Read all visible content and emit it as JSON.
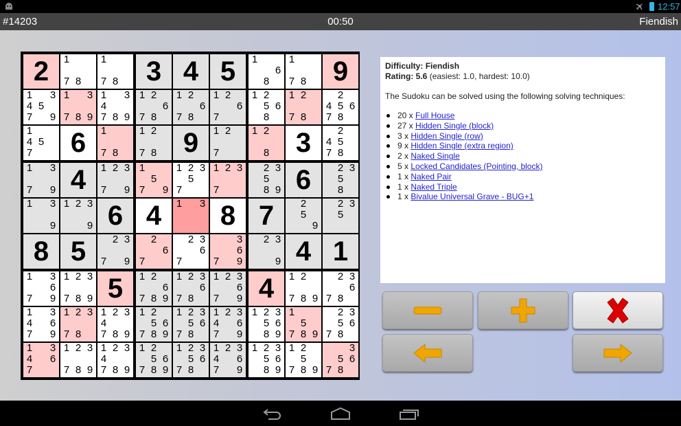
{
  "status_bar": {
    "time": "12:57"
  },
  "header": {
    "puzzle_id": "#14203",
    "timer": "00:50",
    "difficulty": "Fiendish"
  },
  "board": {
    "legend": {
      "w": "white",
      "g": "gray-region",
      "p": "highlight-pink",
      "s": "selected-dark-pink"
    },
    "colors": {
      "w": "#ffffff",
      "g": "#e3e3e3",
      "p": "#ffcccc",
      "s": "#ff9e9e"
    },
    "rows": [
      [
        {
          "bg": "p",
          "v": "2"
        },
        {
          "bg": "w",
          "c": [
            1,
            7,
            8
          ]
        },
        {
          "bg": "w",
          "c": [
            1,
            7,
            8
          ]
        },
        {
          "bg": "g",
          "v": "3"
        },
        {
          "bg": "g",
          "v": "4"
        },
        {
          "bg": "g",
          "v": "5"
        },
        {
          "bg": "w",
          "c": [
            1,
            6,
            8
          ]
        },
        {
          "bg": "w",
          "c": [
            1,
            7,
            8
          ]
        },
        {
          "bg": "p",
          "v": "9"
        }
      ],
      [
        {
          "bg": "w",
          "c": [
            1,
            3,
            4,
            5,
            7,
            9
          ]
        },
        {
          "bg": "p",
          "c": [
            1,
            3,
            7,
            8,
            9
          ]
        },
        {
          "bg": "w",
          "c": [
            1,
            3,
            4,
            7,
            8,
            9
          ]
        },
        {
          "bg": "g",
          "c": [
            1,
            2,
            6,
            7,
            8
          ]
        },
        {
          "bg": "g",
          "c": [
            1,
            2,
            6,
            7,
            8
          ]
        },
        {
          "bg": "g",
          "c": [
            1,
            2,
            6,
            7
          ]
        },
        {
          "bg": "w",
          "c": [
            1,
            2,
            5,
            6,
            8
          ]
        },
        {
          "bg": "p",
          "c": [
            1,
            2,
            7,
            8
          ]
        },
        {
          "bg": "w",
          "c": [
            2,
            4,
            5,
            6,
            7,
            8
          ]
        }
      ],
      [
        {
          "bg": "w",
          "c": [
            1,
            4,
            5,
            7
          ]
        },
        {
          "bg": "w",
          "v": "6"
        },
        {
          "bg": "p",
          "c": [
            1,
            7,
            8
          ]
        },
        {
          "bg": "g",
          "c": [
            1,
            2,
            7,
            8
          ]
        },
        {
          "bg": "g",
          "v": "9"
        },
        {
          "bg": "g",
          "c": [
            1,
            2,
            7
          ]
        },
        {
          "bg": "p",
          "c": [
            1,
            2,
            8
          ]
        },
        {
          "bg": "w",
          "v": "3"
        },
        {
          "bg": "w",
          "c": [
            2,
            4,
            5,
            7,
            8
          ]
        }
      ],
      [
        {
          "bg": "g",
          "c": [
            1,
            3,
            7,
            9
          ]
        },
        {
          "bg": "g",
          "v": "4"
        },
        {
          "bg": "g",
          "c": [
            1,
            2,
            3,
            7,
            9
          ]
        },
        {
          "bg": "p",
          "c": [
            1,
            5,
            7,
            9
          ]
        },
        {
          "bg": "w",
          "c": [
            1,
            2,
            3,
            5,
            7
          ]
        },
        {
          "bg": "p",
          "c": [
            1,
            2,
            3,
            7
          ]
        },
        {
          "bg": "g",
          "c": [
            2,
            3,
            5,
            8,
            9
          ]
        },
        {
          "bg": "g",
          "v": "6"
        },
        {
          "bg": "g",
          "c": [
            2,
            3,
            5,
            8
          ]
        }
      ],
      [
        {
          "bg": "g",
          "c": [
            1,
            3,
            9
          ]
        },
        {
          "bg": "g",
          "c": [
            1,
            2,
            3,
            9
          ]
        },
        {
          "bg": "g",
          "v": "6"
        },
        {
          "bg": "w",
          "v": "4"
        },
        {
          "bg": "s",
          "c": [
            1,
            3
          ]
        },
        {
          "bg": "w",
          "v": "8"
        },
        {
          "bg": "g",
          "v": "7"
        },
        {
          "bg": "g",
          "c": [
            2,
            5,
            9
          ]
        },
        {
          "bg": "g",
          "c": [
            2,
            3,
            5
          ]
        }
      ],
      [
        {
          "bg": "g",
          "v": "8"
        },
        {
          "bg": "g",
          "v": "5"
        },
        {
          "bg": "g",
          "c": [
            2,
            3,
            7,
            9
          ]
        },
        {
          "bg": "p",
          "c": [
            2,
            6,
            7
          ]
        },
        {
          "bg": "w",
          "c": [
            2,
            3,
            6,
            7
          ]
        },
        {
          "bg": "p",
          "c": [
            3,
            6,
            7,
            9
          ]
        },
        {
          "bg": "g",
          "c": [
            2,
            3,
            9
          ]
        },
        {
          "bg": "g",
          "v": "4"
        },
        {
          "bg": "g",
          "v": "1"
        }
      ],
      [
        {
          "bg": "w",
          "c": [
            1,
            3,
            6,
            7,
            9
          ]
        },
        {
          "bg": "w",
          "c": [
            1,
            2,
            3,
            7,
            8,
            9
          ]
        },
        {
          "bg": "p",
          "v": "5"
        },
        {
          "bg": "g",
          "c": [
            1,
            2,
            6,
            7,
            8,
            9
          ]
        },
        {
          "bg": "g",
          "c": [
            1,
            2,
            3,
            6,
            7,
            8
          ]
        },
        {
          "bg": "g",
          "c": [
            1,
            2,
            3,
            6,
            7,
            9
          ]
        },
        {
          "bg": "p",
          "v": "4"
        },
        {
          "bg": "w",
          "c": [
            1,
            2,
            7,
            8,
            9
          ]
        },
        {
          "bg": "w",
          "c": [
            2,
            3,
            6,
            7,
            8
          ]
        }
      ],
      [
        {
          "bg": "w",
          "c": [
            1,
            3,
            4,
            6,
            7,
            9
          ]
        },
        {
          "bg": "p",
          "c": [
            1,
            2,
            3,
            7,
            8
          ]
        },
        {
          "bg": "w",
          "c": [
            1,
            2,
            3,
            4,
            7,
            8,
            9
          ]
        },
        {
          "bg": "g",
          "c": [
            1,
            2,
            5,
            6,
            7,
            8,
            9
          ]
        },
        {
          "bg": "g",
          "c": [
            1,
            2,
            3,
            5,
            6,
            7,
            8
          ]
        },
        {
          "bg": "g",
          "c": [
            1,
            2,
            3,
            4,
            6,
            7,
            9
          ]
        },
        {
          "bg": "w",
          "c": [
            1,
            2,
            3,
            5,
            6,
            8,
            9
          ]
        },
        {
          "bg": "p",
          "c": [
            1,
            5,
            7,
            8,
            9
          ]
        },
        {
          "bg": "w",
          "c": [
            2,
            3,
            5,
            6,
            7,
            8
          ]
        }
      ],
      [
        {
          "bg": "p",
          "c": [
            1,
            3,
            4,
            6,
            7
          ]
        },
        {
          "bg": "w",
          "c": [
            1,
            2,
            3,
            7,
            8,
            9
          ]
        },
        {
          "bg": "w",
          "c": [
            1,
            2,
            3,
            4,
            7,
            8,
            9
          ]
        },
        {
          "bg": "g",
          "c": [
            1,
            2,
            5,
            6,
            7,
            8,
            9
          ]
        },
        {
          "bg": "g",
          "c": [
            1,
            2,
            3,
            5,
            6,
            7,
            8
          ]
        },
        {
          "bg": "g",
          "c": [
            1,
            2,
            3,
            4,
            6,
            7,
            9
          ]
        },
        {
          "bg": "w",
          "c": [
            1,
            2,
            3,
            5,
            6,
            8,
            9
          ]
        },
        {
          "bg": "w",
          "c": [
            1,
            2,
            5,
            7,
            8,
            9
          ]
        },
        {
          "bg": "p",
          "c": [
            3,
            5,
            6,
            7,
            8
          ]
        }
      ]
    ]
  },
  "info": {
    "difficulty_label": "Difficulty:",
    "difficulty_value": "Fiendish",
    "rating_label": "Rating:",
    "rating_value": "5.6",
    "rating_range": "(easiest: 1.0, hardest: 10.0)",
    "intro": "The Sudoku can be solved using the following solving techniques:",
    "techniques": [
      {
        "count": "20 x",
        "name": "Full House"
      },
      {
        "count": "27 x",
        "name": "Hidden Single (block)"
      },
      {
        "count": "3 x",
        "name": "Hidden Single (row)"
      },
      {
        "count": "9 x",
        "name": "Hidden Single (extra region)"
      },
      {
        "count": "2 x",
        "name": "Naked Single"
      },
      {
        "count": "5 x",
        "name": "Locked Candidates (Pointing, block)"
      },
      {
        "count": "1 x",
        "name": "Naked Pair"
      },
      {
        "count": "1 x",
        "name": "Naked Triple"
      },
      {
        "count": "1 x",
        "name": "Bivalue Universal Grave - BUG+1"
      }
    ]
  },
  "controls": {
    "minus": {
      "icon": "minus-icon",
      "color": "#f0a500"
    },
    "plus": {
      "icon": "plus-icon",
      "color": "#f0a500"
    },
    "close": {
      "icon": "close-x-icon",
      "color": "#dd0000"
    },
    "back": {
      "icon": "arrow-left-icon",
      "color": "#f0a500"
    },
    "forward": {
      "icon": "arrow-right-icon",
      "color": "#f0a500"
    }
  }
}
